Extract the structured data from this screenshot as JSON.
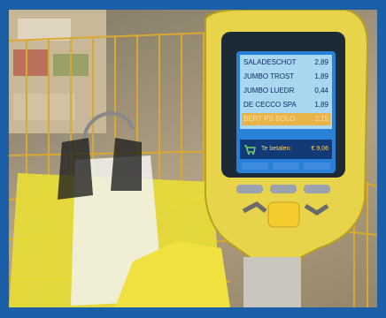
{
  "scanner": {
    "items": [
      {
        "name": "SALADESCHOT",
        "price": "2,89"
      },
      {
        "name": "JUMBO TROST",
        "price": "1,89"
      },
      {
        "name": "JUMBO LUEDR",
        "price": "0,44"
      },
      {
        "name": "DE CECCO SPA",
        "price": "1,89"
      },
      {
        "name": "BERT PS BOLO",
        "price": "2,15"
      }
    ],
    "selected_index": 4,
    "total_label": "Te betalen:",
    "total_amount": "€ 9,06"
  },
  "colors": {
    "frame": "#1a5fa8",
    "scanner_body": "#e8d44a",
    "screen_bg": "#2a7fd6",
    "cart_basket": "#d8a830",
    "bag_yellow": "#f0e040"
  }
}
